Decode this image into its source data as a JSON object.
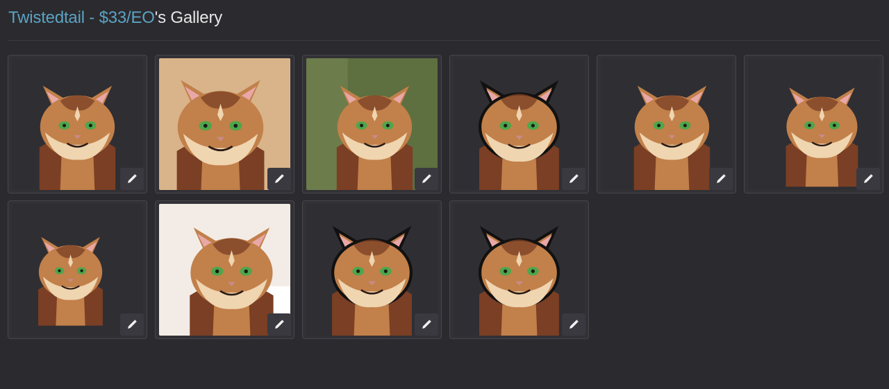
{
  "header": {
    "link_text": "Twistedtail - $33/EO",
    "suffix": "'s Gallery"
  },
  "colors": {
    "background": "#2b2a2e",
    "link": "#5ba3c3",
    "text": "#e6e6e8",
    "fur_dark": "#7a3f24",
    "fur_mid": "#c2804a",
    "fur_light": "#efd5b0",
    "eye": "#4ea64a"
  },
  "gallery": {
    "items": [
      {
        "icon": "pencil-icon",
        "bg": "#2f2e33"
      },
      {
        "icon": "pencil-icon",
        "bg": "#d9b48a"
      },
      {
        "icon": "pencil-icon",
        "bg": "#6b7a4a"
      },
      {
        "icon": "pencil-icon",
        "bg": "#2f2e33"
      },
      {
        "icon": "pencil-icon",
        "bg": "#2f2e33"
      },
      {
        "icon": "pencil-icon",
        "bg": "#2f2e33"
      },
      {
        "icon": "pencil-icon",
        "bg": "#2f2e33"
      },
      {
        "icon": "pencil-icon",
        "bg": "#f3ece6"
      },
      {
        "icon": "pencil-icon",
        "bg": "#2f2e33"
      },
      {
        "icon": "pencil-icon",
        "bg": "#2f2e33"
      }
    ]
  }
}
